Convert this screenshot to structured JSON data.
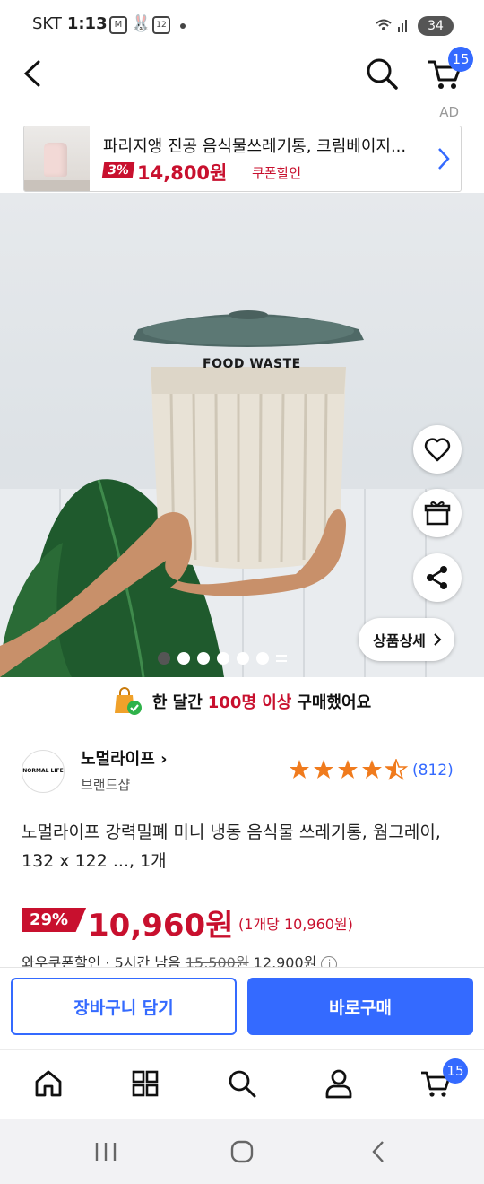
{
  "status_bar": {
    "time": "1:13",
    "carrier": "SKT",
    "notif_badge": "12",
    "battery": "34"
  },
  "header": {
    "cart_count": "15"
  },
  "ad": {
    "label": "AD",
    "title": "파리지앵 진공 음식물쓰레기통, 크림베이지...",
    "discount": "3%",
    "price": "14,800원",
    "coupon": "쿠폰할인"
  },
  "hero": {
    "lid_text": "FOOD WASTE",
    "detail_button": "상품상세",
    "slide_count": 7,
    "current_slide": 1
  },
  "purchase_banner": {
    "prefix": "한 달간",
    "highlight": "100명 이상",
    "suffix": "구매했어요"
  },
  "brand": {
    "logo_text": "NORMAL LIFE",
    "name": "노멀라이프",
    "subtitle": "브랜드샵"
  },
  "rating": {
    "stars": 4.5,
    "count": "(812)"
  },
  "product": {
    "title": "노멀라이프 강력밀폐 미니 냉동 음식물 쓰레기통, 웜그레이, 132 x 122 ..., 1개",
    "discount": "29%",
    "price": "10,960원",
    "unit_price": "(1개당 10,960원)",
    "coupon_line": {
      "label": "와우쿠폰할인",
      "separator": "·",
      "time_left": "5시간 남음",
      "original": "15,500원",
      "coupon_price": "12,900원"
    }
  },
  "actions": {
    "add_to_cart": "장바구니 담기",
    "buy_now": "바로구매"
  },
  "tabbar": {
    "cart_count": "15",
    "items": [
      "home-icon",
      "category-icon",
      "search-icon",
      "user-icon",
      "cart-icon"
    ]
  },
  "colors": {
    "accent": "#346aff",
    "sale": "#c8102e",
    "star": "#f07b1d"
  }
}
